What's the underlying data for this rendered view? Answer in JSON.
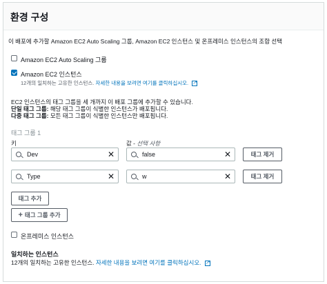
{
  "header": {
    "title": "환경 구성"
  },
  "description": "이 배포에 추가할 Amazon EC2 Auto Scaling 그룹, Amazon EC2 인스턴스 및 온프레미스 인스턴스의 조합 선택",
  "options": {
    "asg": {
      "label": "Amazon EC2 Auto Scaling 그룹",
      "checked": false
    },
    "ec2": {
      "label": "Amazon EC2 인스턴스",
      "checked": true,
      "match_text": "12개의 일치하는 고유한 인스턴스.",
      "link_text": "자세한 내용을 보려면 여기를 클릭하십시오."
    }
  },
  "tag_info": {
    "line1": "EC2 인스턴스의 태그 그룹을 세 개까지 이 배포 그룹에 추가할 수 있습니다.",
    "line2_bold": "단일 태그 그룹:",
    "line2_rest": " 해당 태그 그룹이 식별한 인스턴스가 배포됩니다.",
    "line3_bold": "다중 태그 그룹:",
    "line3_rest": " 모든 태그 그룹이 식별한 인스턴스만 배포됩니다."
  },
  "tag_group": {
    "title": "태그 그룹 1",
    "key_label": "키",
    "value_label": "값 - ",
    "value_optional": "선택 사항",
    "rows": [
      {
        "key": "Dev",
        "value": "false",
        "remove_label": "태그 제거"
      },
      {
        "key": "Type",
        "value": "w",
        "remove_label": "태그 제거"
      }
    ],
    "add_tag_label": "태그 추가"
  },
  "add_group_label": "태그 그룹 추가",
  "onprem": {
    "label": "온프레미스 인스턴스",
    "checked": false
  },
  "matching": {
    "title": "일치하는 인스턴스",
    "text": "12개의 일치하는 고유한 인스턴스.",
    "link_text": "자세한 내용을 보려면 여기를 클릭하십시오."
  }
}
